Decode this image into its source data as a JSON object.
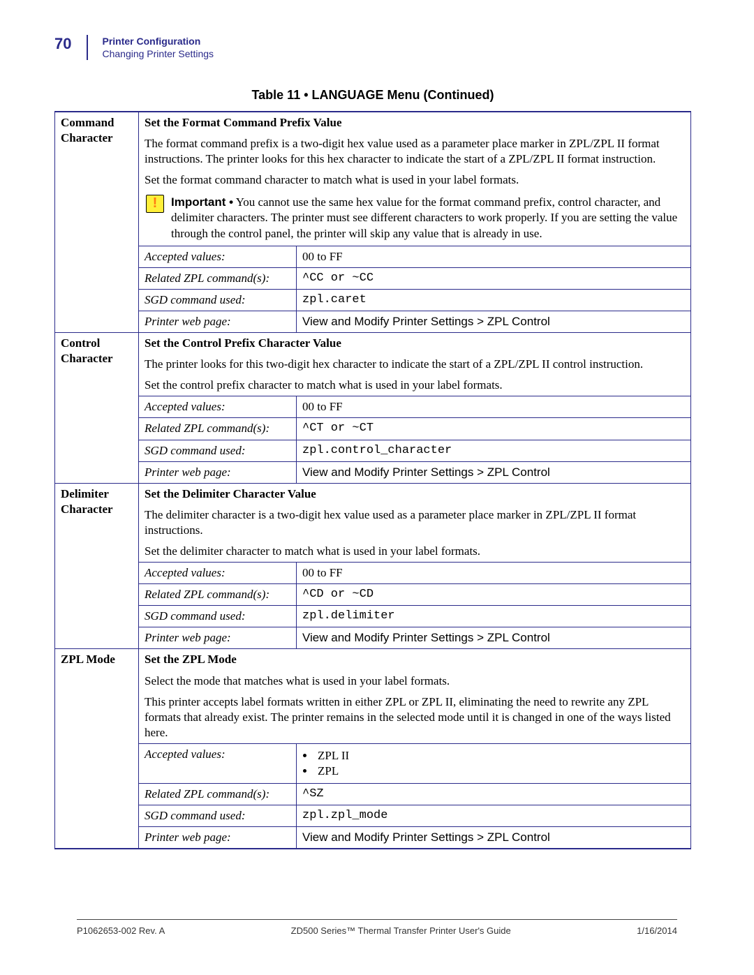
{
  "header": {
    "page_number": "70",
    "section": "Printer Configuration",
    "subsection": "Changing Printer Settings"
  },
  "caption": "Table 11 • LANGUAGE Menu  (Continued)",
  "labels": {
    "accepted_values": "Accepted values:",
    "related_zpl": "Related ZPL command(s):",
    "sgd_used": "SGD command used:",
    "webpage": "Printer web page:"
  },
  "rows": {
    "command_char": {
      "name": "Command Character",
      "title": "Set the Format Command Prefix Value",
      "desc1": "The format command prefix is a two-digit hex value used as a parameter place marker in ZPL/ZPL II format instructions. The printer looks for this hex character to indicate the start of a ZPL/ZPL II format instruction.",
      "desc2": "Set the format command character to match what is used in your label formats.",
      "important_label": "Important •",
      "important": "You cannot use the same hex value for the format command prefix, control character, and delimiter characters. The printer must see different characters to work properly. If you are setting the value through the control panel, the printer will skip any value that is already in use.",
      "accepted": "00 to FF",
      "zpl": "^CC or ~CC",
      "sgd": "zpl.caret",
      "webpage": "View and Modify Printer Settings > ZPL Control"
    },
    "control_char": {
      "name": "Control Character",
      "title": "Set the Control Prefix Character Value",
      "desc1": "The printer looks for this two-digit hex character to indicate the start of a ZPL/ZPL II control instruction.",
      "desc2": "Set the control prefix character to match what is used in your label formats.",
      "accepted": "00 to FF",
      "zpl": "^CT or ~CT",
      "sgd": "zpl.control_character",
      "webpage": "View and Modify Printer Settings > ZPL Control"
    },
    "delimiter": {
      "name": "Delimiter Character",
      "title": "Set the Delimiter Character Value",
      "desc1": "The delimiter character is a two-digit hex value used as a parameter place marker in ZPL/ZPL II format instructions.",
      "desc2": "Set the delimiter character to match what is used in your label formats.",
      "accepted": "00 to FF",
      "zpl": "^CD or ~CD",
      "sgd": "zpl.delimiter",
      "webpage": "View and Modify Printer Settings > ZPL Control"
    },
    "zpl_mode": {
      "name": "ZPL Mode",
      "title": "Set the ZPL Mode",
      "desc1": "Select the mode that matches what is used in your label formats.",
      "desc2": "This printer accepts label formats written in either ZPL or ZPL II, eliminating the need to rewrite any ZPL formats that already exist. The printer remains in the selected mode until it is changed in one of the ways listed here.",
      "accepted_list": [
        "ZPL II",
        "ZPL"
      ],
      "zpl": "^SZ",
      "sgd": "zpl.zpl_mode",
      "webpage": "View and Modify Printer Settings > ZPL Control"
    }
  },
  "footer": {
    "left": "P1062653-002 Rev. A",
    "center": "ZD500 Series™ Thermal Transfer Printer User's Guide",
    "right": "1/16/2014"
  }
}
